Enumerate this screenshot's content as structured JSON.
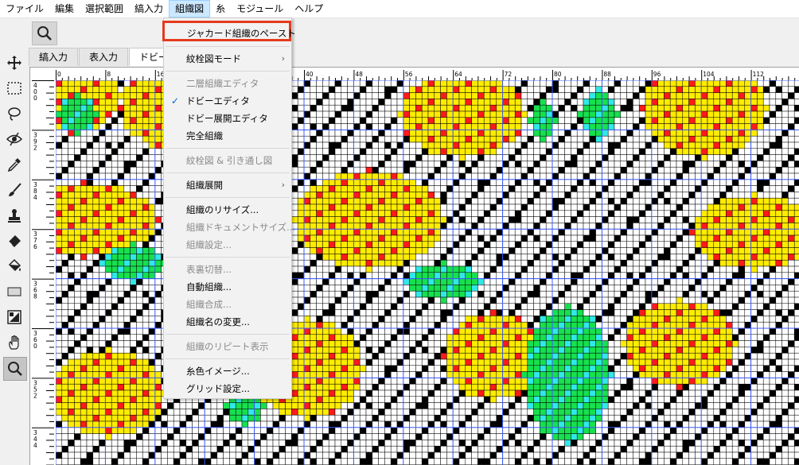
{
  "menubar": {
    "items": [
      "ファイル",
      "編集",
      "選択範囲",
      "縞入力",
      "組織図",
      "糸",
      "モジュール",
      "ヘルプ"
    ],
    "open_index": 4
  },
  "tabs": [
    "縞入力",
    "表入力",
    "ドビー組"
  ],
  "active_tab": 2,
  "tools": [
    "move-icon",
    "rect-select-icon",
    "lasso-icon",
    "eye-icon",
    "eyedropper-icon",
    "brush-icon",
    "stamp-icon",
    "eraser-icon",
    "fill-bucket-icon",
    "rectangle-icon",
    "pattern-icon",
    "hand-icon",
    "zoom-icon"
  ],
  "dropdown": {
    "items": [
      {
        "label": "ジャカード組織のペースト",
        "enabled": true,
        "highlight": true
      },
      {
        "sep": true
      },
      {
        "label": "紋栓図モード",
        "enabled": true,
        "submenu": true
      },
      {
        "sep": true
      },
      {
        "label": "二層組織エディタ",
        "enabled": false
      },
      {
        "label": "ドビーエディタ",
        "enabled": true,
        "checked": true
      },
      {
        "label": "ドビー展開エディタ",
        "enabled": true
      },
      {
        "label": "完全組織",
        "enabled": true
      },
      {
        "sep": true
      },
      {
        "label": "紋栓図 & 引き通し図",
        "enabled": false
      },
      {
        "sep": true
      },
      {
        "label": "組織展開",
        "enabled": true,
        "submenu": true
      },
      {
        "sep": true
      },
      {
        "label": "組織のリサイズ...",
        "enabled": true
      },
      {
        "label": "組織ドキュメントサイズ...",
        "enabled": false
      },
      {
        "label": "組織設定...",
        "enabled": false
      },
      {
        "sep": true
      },
      {
        "label": "表裏切替...",
        "enabled": false
      },
      {
        "label": "自動組織...",
        "enabled": true
      },
      {
        "label": "組織合成...",
        "enabled": false
      },
      {
        "label": "組織名の変更...",
        "enabled": true
      },
      {
        "sep": true
      },
      {
        "label": "組織のリピート表示",
        "enabled": false
      },
      {
        "sep": true
      },
      {
        "label": "糸色イメージ...",
        "enabled": true
      },
      {
        "label": "グリッド設定...",
        "enabled": true
      }
    ]
  },
  "ruler": {
    "top_labels": [
      "0",
      "8",
      "16",
      "24",
      "32",
      "40",
      "48",
      "56",
      "64",
      "72",
      "80",
      "88",
      "96",
      "104",
      "112"
    ],
    "left_labels": [
      "400",
      "392",
      "384",
      "376",
      "368",
      "360",
      "352",
      "344"
    ]
  },
  "colors": {
    "yellow": "#ffec00",
    "red": "#ff1a1a",
    "green": "#17e04f",
    "cyan": "#30e8e8",
    "black": "#000000",
    "white": "#ffffff",
    "grid_line": "#000000",
    "accent": "#0078d7",
    "highlight_border": "#e53a1e"
  }
}
